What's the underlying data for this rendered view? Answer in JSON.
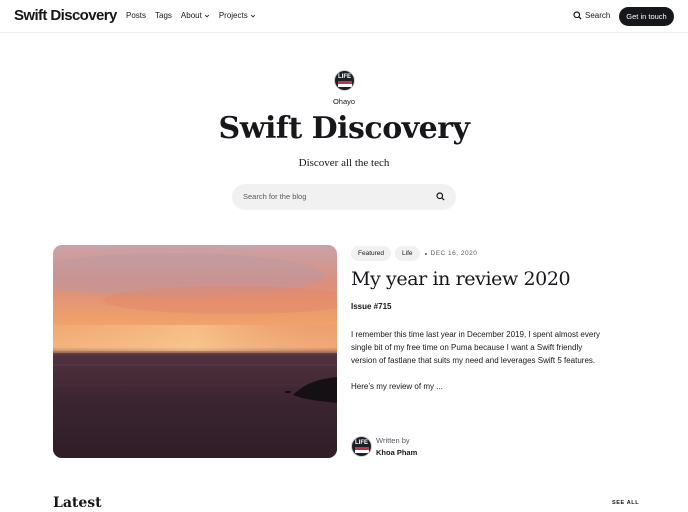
{
  "header": {
    "logo": "Swift Discovery",
    "nav": [
      {
        "label": "Posts",
        "has_menu": false
      },
      {
        "label": "Tags",
        "has_menu": false
      },
      {
        "label": "About",
        "has_menu": true
      },
      {
        "label": "Projects",
        "has_menu": true
      }
    ],
    "search_label": "Search",
    "cta_label": "Get in touch"
  },
  "hero": {
    "avatar_text": "LIFE",
    "name": "Ohayo",
    "title": "Swift Discovery",
    "subtitle": "Discover all the tech",
    "search_placeholder": "Search for the blog"
  },
  "featured": {
    "tags": [
      "Featured",
      "Life"
    ],
    "date": "DEC 16, 2020",
    "title": "My year in review 2020",
    "issue": "Issue #715",
    "excerpt": [
      "I remember this time last year in December 2019, I spent almost every single bit of my free time on Puma because I want a Swift friendly version of fastlane that suits my need and leverages Swift 5 features.",
      "Here’s my review of my ..."
    ],
    "written_by_label": "Written by",
    "author": "Khoa Pham"
  },
  "latest": {
    "heading": "Latest",
    "see_all": "SEE ALL"
  },
  "colors": {
    "text": "#15171a",
    "button_bg": "#15171a",
    "chip_bg": "#f1f1f1"
  }
}
